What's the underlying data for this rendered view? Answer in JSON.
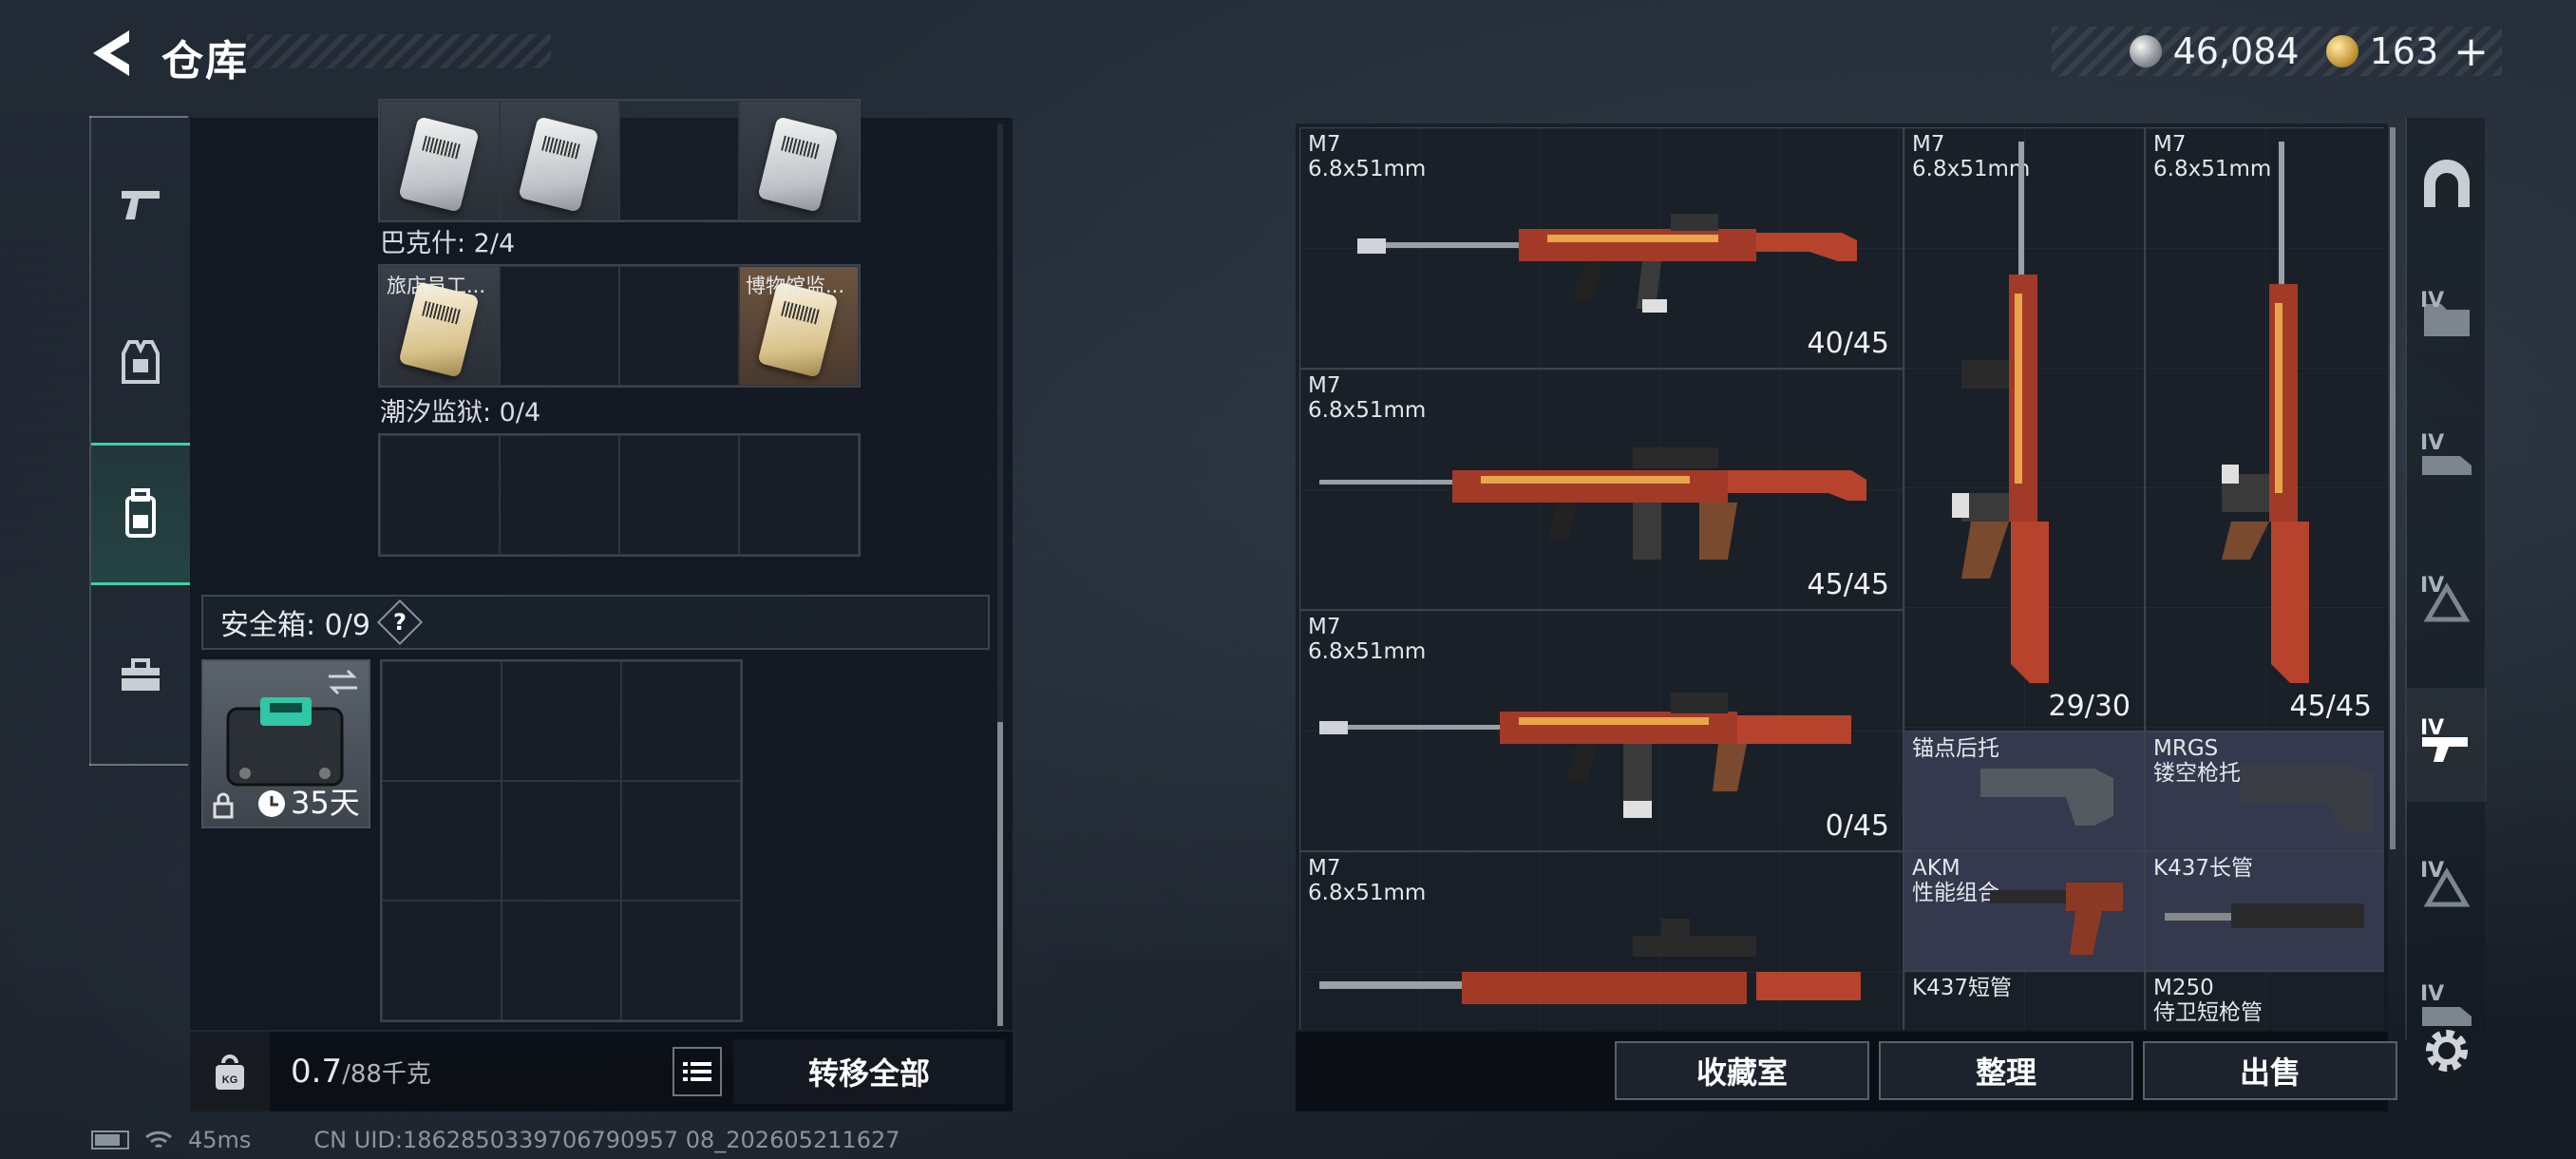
{
  "header": {
    "title": "仓库",
    "silver": "46,084",
    "gold": "163",
    "plus": "+"
  },
  "left_sidebar": {
    "items": [
      {
        "name": "weapons"
      },
      {
        "name": "gear"
      },
      {
        "name": "backpack",
        "active": true
      },
      {
        "name": "toolbox"
      }
    ]
  },
  "collection": {
    "row1": [
      {
        "label": "",
        "item": "card"
      },
      {
        "label": "",
        "item": "card"
      },
      {
        "label": "",
        "item": ""
      },
      {
        "label": "",
        "item": "card"
      }
    ],
    "bakeshi_label": "巴克什: 2/4",
    "row2": [
      {
        "label": "旅店员工...",
        "item": "card-gold"
      },
      {
        "label": "",
        "item": ""
      },
      {
        "label": "",
        "item": ""
      },
      {
        "label": "博物馆监...",
        "item": "card-gold",
        "brown": true
      }
    ],
    "chaoxi_label": "潮汐监狱: 0/4"
  },
  "safe": {
    "label": "安全箱: 0/9",
    "help": "?",
    "days": "35天"
  },
  "weight": {
    "current": "0.7",
    "max": "/88千克"
  },
  "buttons": {
    "transfer_all": "转移全部",
    "favorites": "收藏室",
    "organize": "整理",
    "sell": "出售"
  },
  "status": {
    "ping": "45ms",
    "uid": "CN UID:1862850339706790957 08_202605211627"
  },
  "inventory": [
    {
      "id": "m7-a",
      "name": "M7\n6.8x51mm",
      "ammo": "40/45"
    },
    {
      "id": "m7-b",
      "name": "M7\n6.8x51mm",
      "ammo": "45/45"
    },
    {
      "id": "m7-c",
      "name": "M7\n6.8x51mm",
      "ammo": "0/45"
    },
    {
      "id": "m7-d",
      "name": "M7\n6.8x51mm",
      "ammo": ""
    },
    {
      "id": "m7-v1",
      "name": "M7\n6.8x51mm",
      "ammo": "29/30"
    },
    {
      "id": "m7-v2",
      "name": "M7\n6.8x51mm",
      "ammo": "45/45"
    },
    {
      "id": "anchor",
      "name": "锚点后托",
      "ammo": ""
    },
    {
      "id": "mrgs",
      "name": "MRGS\n镂空枪托",
      "ammo": ""
    },
    {
      "id": "akm",
      "name": "AKM\n性能组合",
      "ammo": ""
    },
    {
      "id": "k437l",
      "name": "K437长管",
      "ammo": ""
    },
    {
      "id": "k437s",
      "name": "K437短管",
      "ammo": ""
    },
    {
      "id": "m250",
      "name": "M250\n侍卫短枪管",
      "ammo": ""
    }
  ],
  "right_sidebar": {
    "tiers": [
      "IV",
      "IV",
      "IV",
      "IV",
      "IV",
      "IV"
    ]
  },
  "colors": {
    "accent": "#3fd1a5",
    "panel": "#10161e",
    "gun_red": "#b8432c"
  }
}
